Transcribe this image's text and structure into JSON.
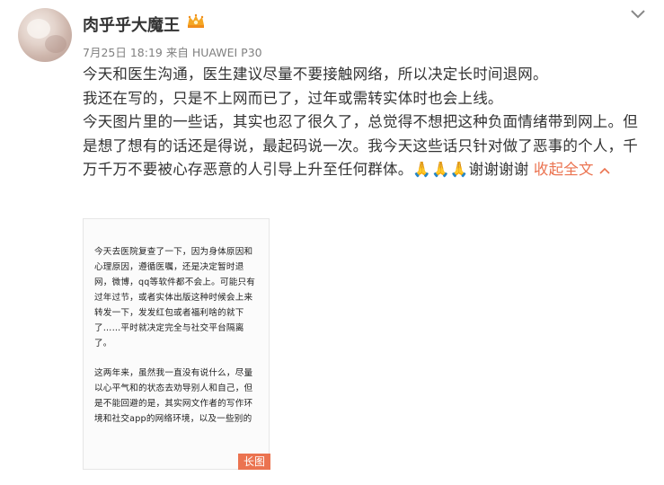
{
  "post": {
    "author": "肉乎乎大魔王",
    "vip_icon": "vip-crown-icon",
    "menu_icon": "chevron-down-icon",
    "timestamp": "7月25日 18:19",
    "source_prefix": "来自",
    "source_device": "HUAWEI P30",
    "paragraphs": [
      "今天和医生沟通，医生建议尽量不要接触网络，所以决定长时间退网。",
      "我还在写的，只是不上网而已了，过年或需转实体时也会上线。",
      "今天图片里的一些话，其实也忍了很久了，总觉得不想把这种负面情绪带到网上。但是想了想有的话还是得说，最起码说一次。我今天这些话只针对做了恶事的个人，千万千万不要被心存恶意的人引导上升至任何群体。🙏🙏🙏谢谢谢谢"
    ],
    "collapse_label": "收起全文",
    "image": {
      "paragraphs": [
        "今天去医院复查了一下，因为身体原因和心理原因，遵循医嘱，还是决定暂时退网，微博，qq等软件都不会上。可能只有过年过节，或者实体出版这种时候会上来转发一下，发发红包或者福利啥的就下了……平时就决定完全与社交平台隔离了。",
        "这两年来，虽然我一直没有说什么，尽量以心平气和的状态去劝导别人和自己，但是不能回避的是，其实网文作者的写作环境和社交app的网络环境，以及一些别的"
      ],
      "badge": "长图"
    }
  },
  "colors": {
    "accent": "#eb7350",
    "meta_text": "#808080",
    "body_text": "#333333"
  }
}
